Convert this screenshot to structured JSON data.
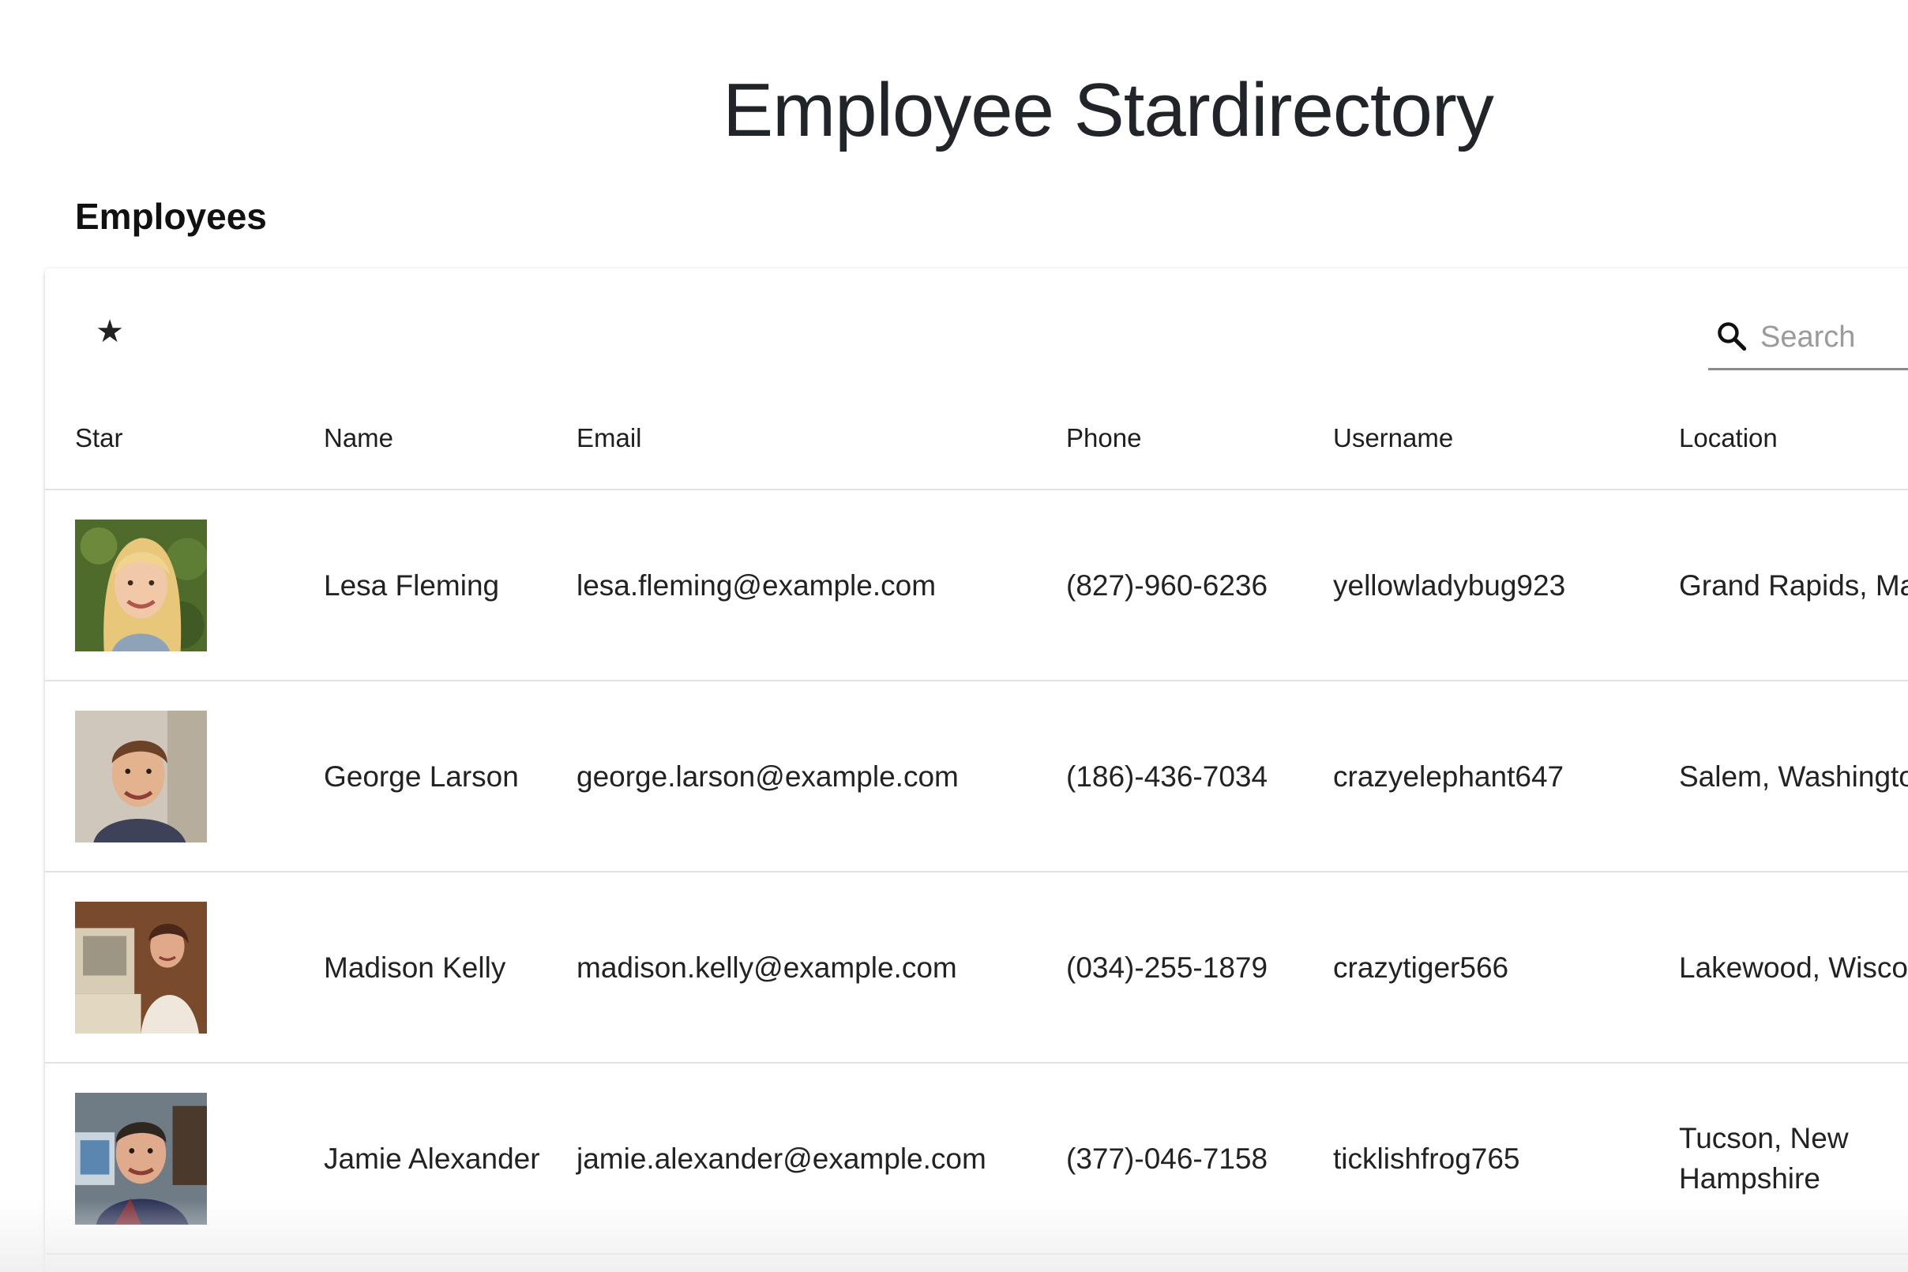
{
  "header": {
    "title": "Employee Stardirectory"
  },
  "section": {
    "title": "Employees"
  },
  "toolbar": {
    "star_glyph": "★",
    "star_icon": "star-icon",
    "search_icon": "search-icon",
    "search_placeholder": "Search",
    "search_value": ""
  },
  "table": {
    "columns": {
      "star": "Star",
      "name": "Name",
      "email": "Email",
      "phone": "Phone",
      "username": "Username",
      "location": "Location"
    },
    "rows": [
      {
        "name": "Lesa Fleming",
        "email": "lesa.fleming@example.com",
        "phone": "(827)-960-6236",
        "username": "yellowladybug923",
        "location": "Grand Rapids, Maine"
      },
      {
        "name": "George Larson",
        "email": "george.larson@example.com",
        "phone": "(186)-436-7034",
        "username": "crazyelephant647",
        "location": "Salem, Washington"
      },
      {
        "name": "Madison Kelly",
        "email": "madison.kelly@example.com",
        "phone": "(034)-255-1879",
        "username": "crazytiger566",
        "location": "Lakewood, Wisconsin"
      },
      {
        "name": "Jamie Alexander",
        "email": "jamie.alexander@example.com",
        "phone": "(377)-046-7158",
        "username": "ticklishfrog765",
        "location": "Tucson, New Hampshire"
      }
    ]
  },
  "colors": {
    "text": "#212529",
    "divider": "#e2e2e2",
    "placeholder": "#9b9b9b"
  }
}
